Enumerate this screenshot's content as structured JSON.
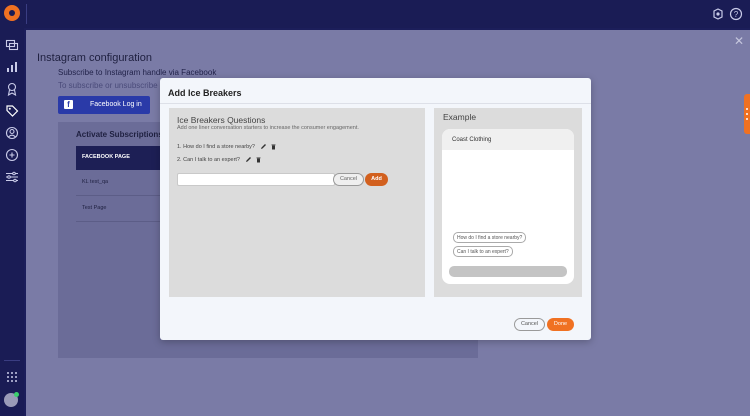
{
  "main": {
    "page_title": "Instagram configuration",
    "subscribe_text": "Subscribe to Instagram handle via Facebook",
    "subscribe_sub": "To subscribe or unsubscribe",
    "facebook_login_label": "Facebook Log in",
    "activate_subscriptions": "Activate Subscriptions",
    "table": {
      "header": "FACEBOOK PAGE",
      "rows": [
        "KL test_qa",
        "Test Page"
      ]
    }
  },
  "modal": {
    "title": "Add Ice Breakers",
    "left": {
      "title": "Ice Breakers Questions",
      "description": "Add one liner conversation starters to increase the consumer engagement.",
      "items": [
        "1. How do I find a store nearby?",
        "2. Can I talk to an expert?"
      ],
      "input_placeholder": "",
      "cancel_label": "Cancel",
      "add_label": "Add"
    },
    "right": {
      "title": "Example",
      "brand": "Coast Clothing",
      "chips": [
        "How do I find a store nearby?",
        "Can I talk to an expert?"
      ]
    },
    "footer": {
      "cancel_label": "Cancel",
      "done_label": "Done"
    }
  },
  "colors": {
    "accent": "#f07122",
    "navy": "#1a1c55",
    "facebook": "#2a3aa8"
  }
}
